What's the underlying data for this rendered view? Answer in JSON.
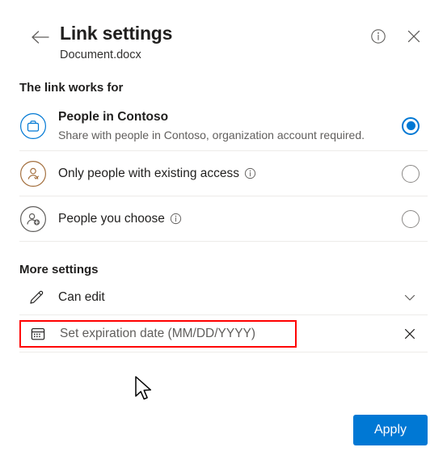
{
  "header": {
    "title": "Link settings",
    "subtitle": "Document.docx",
    "back_icon": "arrow-left-icon",
    "info_icon": "info-icon",
    "close_icon": "close-icon"
  },
  "link_works_for": {
    "section_label": "The link works for",
    "options": [
      {
        "id": "people-in-contoso",
        "icon": "briefcase-icon",
        "title": "People in Contoso",
        "description": "Share with people in Contoso, organization account required.",
        "selected": true,
        "has_info": false
      },
      {
        "id": "existing-access",
        "icon": "person-check-icon",
        "title": "Only people with existing access",
        "description": "",
        "selected": false,
        "has_info": true
      },
      {
        "id": "people-you-choose",
        "icon": "person-add-icon",
        "title": "People you choose",
        "description": "",
        "selected": false,
        "has_info": true
      }
    ]
  },
  "more_settings": {
    "section_label": "More settings",
    "permission": {
      "icon": "pencil-icon",
      "label": "Can edit",
      "trailing_icon": "chevron-down-icon"
    },
    "expiration": {
      "icon": "calendar-icon",
      "placeholder": "Set expiration date (MM/DD/YYYY)",
      "value": "",
      "trailing_icon": "close-icon",
      "highlight_color": "#ff0000"
    }
  },
  "footer": {
    "apply_label": "Apply"
  },
  "colors": {
    "accent": "#0078d4",
    "contoso_icon": "#0078d4",
    "existing_access_icon": "#a4703f",
    "people_choose_icon": "#605e5c",
    "divider": "#edebe9",
    "highlight": "#ff0000"
  }
}
